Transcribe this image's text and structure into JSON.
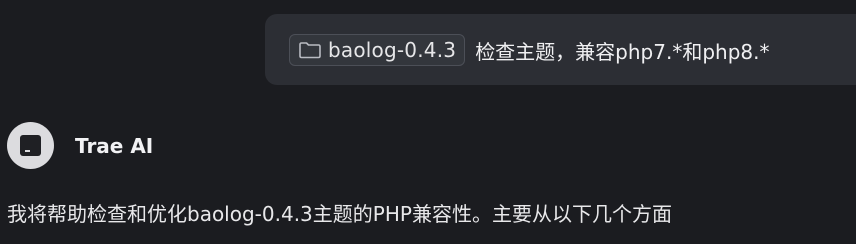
{
  "user_message": {
    "attachment": {
      "icon": "folder-icon",
      "label": "baolog-0.4.3"
    },
    "text": "检查主题，兼容php7.*和php8.*"
  },
  "assistant": {
    "avatar_icon": "trae-logo-icon",
    "name": "Trae AI",
    "text": "我将帮助检查和优化baolog-0.4.3主题的PHP兼容性。主要从以下几个方面"
  }
}
